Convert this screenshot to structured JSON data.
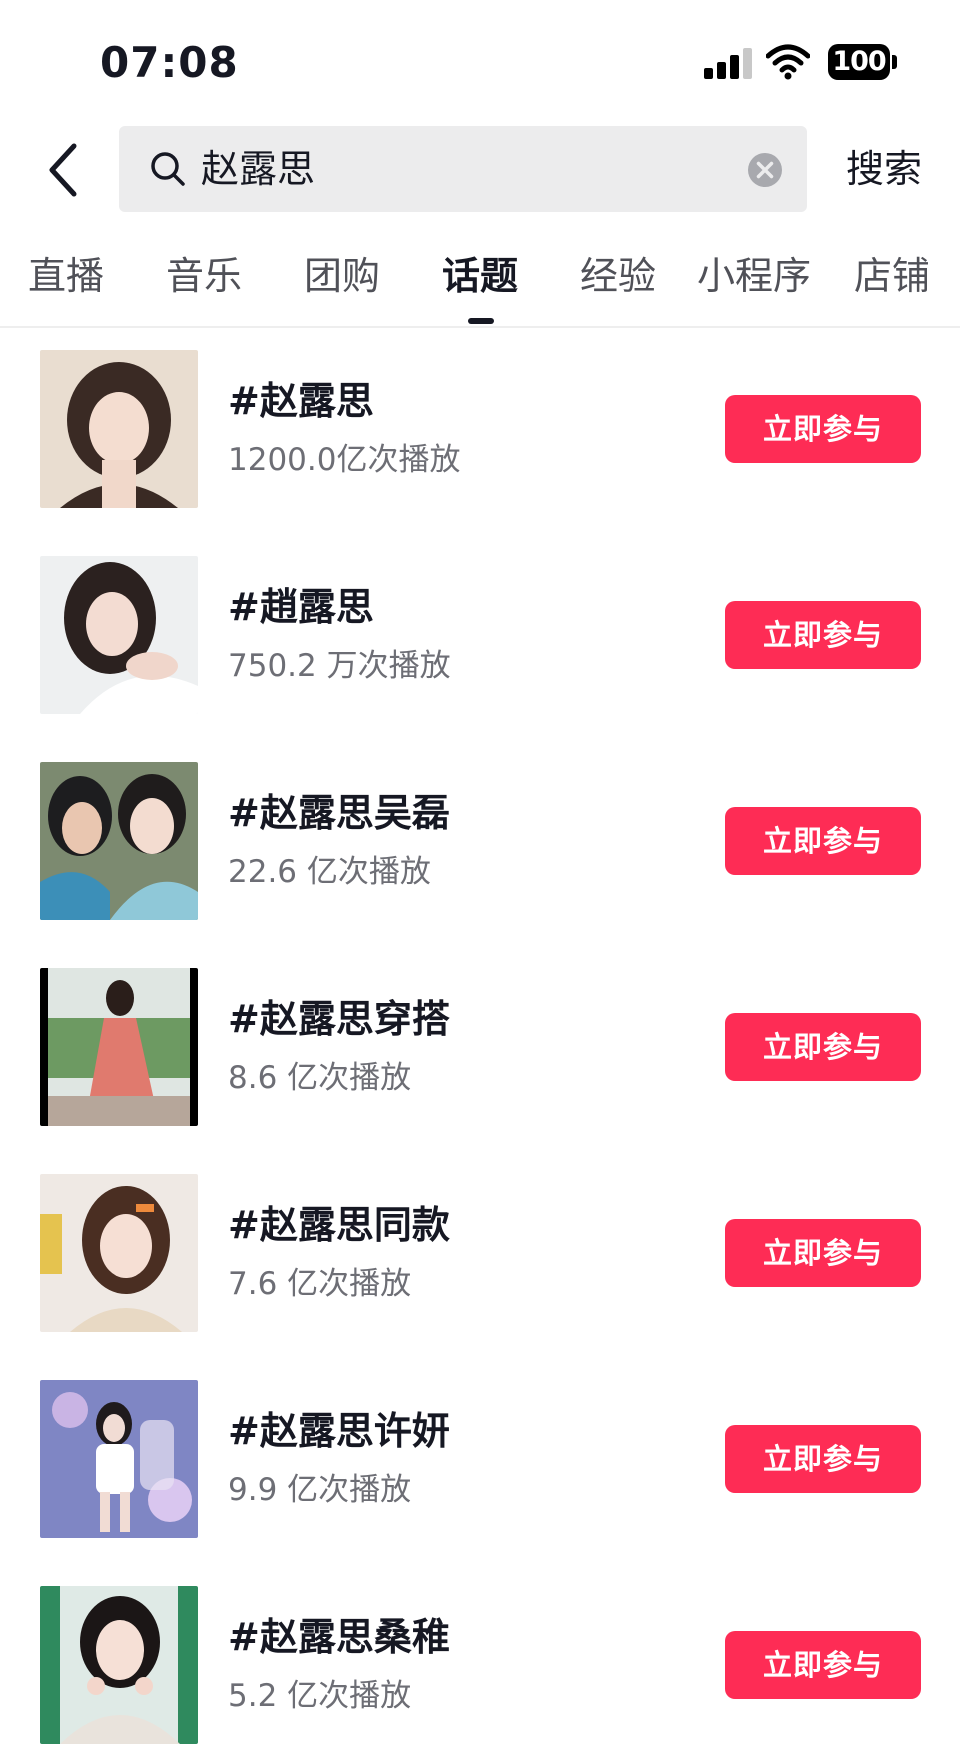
{
  "status_bar": {
    "time": "07:08",
    "battery": "100"
  },
  "search": {
    "query": "赵露思",
    "submit_label": "搜索"
  },
  "tabs": [
    {
      "label": "直播"
    },
    {
      "label": "音乐"
    },
    {
      "label": "团购"
    },
    {
      "label": "话题",
      "active": true
    },
    {
      "label": "经验"
    },
    {
      "label": "小程序"
    },
    {
      "label": "店铺"
    }
  ],
  "topics": [
    {
      "title": "#赵露思",
      "plays": "1200.0亿次播放",
      "button": "立即参与"
    },
    {
      "title": "#趙露思",
      "plays": "750.2 万次播放",
      "button": "立即参与"
    },
    {
      "title": "#赵露思吴磊",
      "plays": "22.6 亿次播放",
      "button": "立即参与"
    },
    {
      "title": "#赵露思穿搭",
      "plays": "8.6 亿次播放",
      "button": "立即参与"
    },
    {
      "title": "#赵露思同款",
      "plays": "7.6 亿次播放",
      "button": "立即参与"
    },
    {
      "title": "#赵露思许妍",
      "plays": "9.9 亿次播放",
      "button": "立即参与"
    },
    {
      "title": "#赵露思桑稚",
      "plays": "5.2 亿次播放",
      "button": "立即参与"
    }
  ],
  "colors": {
    "accent": "#fe2c55",
    "search_bg": "#ececed",
    "secondary_text": "#6d6e75"
  }
}
